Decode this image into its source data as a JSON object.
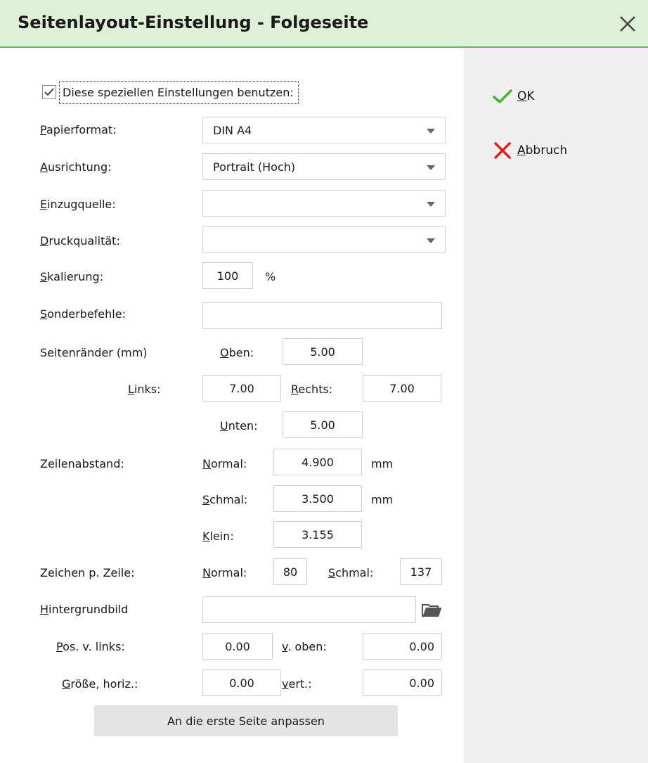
{
  "window": {
    "title": "Seitenlayout-Einstellung - Folgeseite"
  },
  "actions": {
    "ok": {
      "key": "O",
      "rest": "K"
    },
    "cancel": {
      "key": "A",
      "rest": "bbruch"
    }
  },
  "checkbox": {
    "label": "Diese speziellen Einstellungen benutzen:",
    "checked": true
  },
  "labels": {
    "papierformat": {
      "key": "P",
      "rest": "apierformat:"
    },
    "ausrichtung": {
      "key": "A",
      "rest": "usrichtung:"
    },
    "einzugquelle": {
      "key": "E",
      "rest": "inzugquelle:"
    },
    "druckqualitaet": {
      "key": "D",
      "rest": "ruckqualität:"
    },
    "skalierung": {
      "key": "S",
      "rest": "kalierung:"
    },
    "sonderbefehle": {
      "key": "S",
      "rest": "onderbefehle:"
    },
    "seitenraender": "Seitenränder (mm)",
    "oben": {
      "key": "O",
      "rest": "ben:"
    },
    "links": {
      "key": "L",
      "rest": "inks:"
    },
    "rechts": {
      "key": "R",
      "rest": "echts:"
    },
    "unten": {
      "key": "U",
      "rest": "nten:"
    },
    "zeilenabstand": "Zeilenabstand:",
    "normal": {
      "key": "N",
      "rest": "ormal:"
    },
    "schmal": {
      "key": "S",
      "rest": "chmal:"
    },
    "klein": {
      "key": "K",
      "rest": "lein:"
    },
    "zeichen_p_zeile": "Zeichen p. Zeile:",
    "zeichen_normal": {
      "key": "N",
      "rest": "ormal:"
    },
    "zeichen_schmal": {
      "key": "S",
      "rest": "chmal:"
    },
    "hintergrundbild": {
      "key": "H",
      "rest": "intergrundbild"
    },
    "pos_links": {
      "key": "P",
      "rest": "os. v. links:"
    },
    "v_oben": {
      "key": "v",
      "rest": ". oben:"
    },
    "groesse_horiz": {
      "key": "G",
      "rest": "röße, horiz.:"
    },
    "vert": {
      "key": "v",
      "rest": "ert.:"
    },
    "unit_percent": "%",
    "unit_mm_1": "mm",
    "unit_mm_2": "mm"
  },
  "values": {
    "papierformat": "DIN A4",
    "ausrichtung": "Portrait (Hoch)",
    "einzugquelle": "",
    "druckqualitaet": "",
    "skalierung": "100",
    "sonderbefehle": "",
    "oben": "5.00",
    "links": "7.00",
    "rechts": "7.00",
    "unten": "5.00",
    "zeilen_normal": "4.900",
    "zeilen_schmal": "3.500",
    "zeilen_klein": "3.155",
    "zeichen_normal": "80",
    "zeichen_schmal": "137",
    "hintergrundbild": "",
    "pos_links": "0.00",
    "v_oben": "0.00",
    "groesse_horiz": "0.00",
    "vert": "0.00"
  },
  "buttons": {
    "fit_first_page": "An die erste Seite anpassen"
  },
  "colors": {
    "title_bg": "#dff0d8",
    "title_border": "#6bb35a",
    "ok_check": "#4caf3a",
    "cancel_x": "#e02020",
    "side_panel": "#f0f0f0"
  },
  "icons": {
    "close": "close-icon",
    "ok": "checkmark-icon",
    "cancel": "cross-icon",
    "folder": "folder-open-icon"
  }
}
